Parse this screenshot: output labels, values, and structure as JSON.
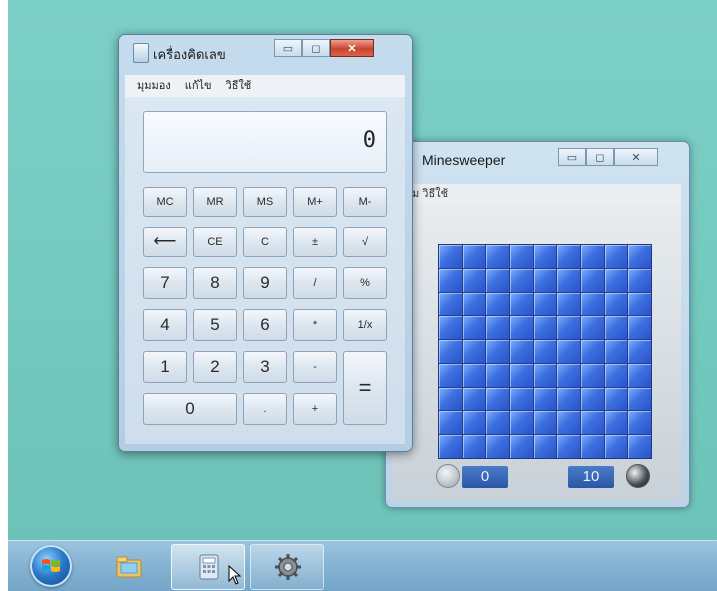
{
  "calculator": {
    "title": "เครื่องคิดเลข",
    "menu": [
      "มุมมอง",
      "แก้ไข",
      "วิธีใช้"
    ],
    "display": "0",
    "buttons": {
      "mc": "MC",
      "mr": "MR",
      "ms": "MS",
      "mplus": "M+",
      "mminus": "M-",
      "back": "⟵",
      "ce": "CE",
      "c": "C",
      "plusminus": "±",
      "sqrt": "√",
      "n7": "7",
      "n8": "8",
      "n9": "9",
      "div": "/",
      "pct": "%",
      "n4": "4",
      "n5": "5",
      "n6": "6",
      "mul": "*",
      "inv": "1/x",
      "n1": "1",
      "n2": "2",
      "n3": "3",
      "sub": "-",
      "eq": "=",
      "n0": "0",
      "dot": ".",
      "add": "+"
    }
  },
  "minesweeper": {
    "title": "Minesweeper",
    "menu_partial": "ม วิธีใช้",
    "timer": "0",
    "mines": "10",
    "grid": {
      "rows": 9,
      "cols": 9
    }
  },
  "taskbar": {
    "items": [
      "start-button",
      "windows-explorer",
      "calculator",
      "control-panel"
    ]
  },
  "colors": {
    "desktop": "#74c9bf",
    "tile_blue": "#3d6fe0",
    "close_red": "#c8452f"
  }
}
